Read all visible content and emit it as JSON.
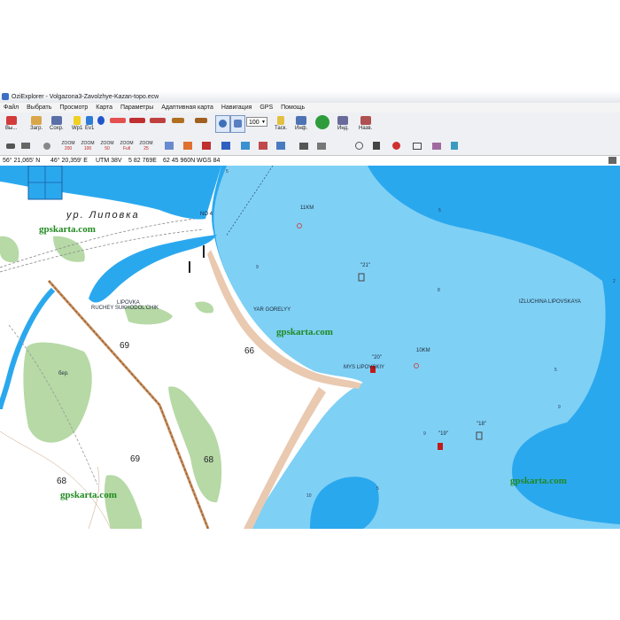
{
  "window": {
    "title": "OziExplorer - Volgazona3-Zavolzhye-Kazan-topo.ecw"
  },
  "menu": [
    "Файл",
    "Выбрать",
    "Просмотр",
    "Карта",
    "Параметры",
    "Адаптивная карта",
    "Навигация",
    "GPS",
    "Помощь"
  ],
  "toolbar1": {
    "exit": "Вы...",
    "load": "Загр.",
    "save": "Сохр.",
    "wp1": "Wp1",
    "ev1": "Ev1",
    "zoom_value": "100",
    "task": "Таск.",
    "info": "Инф.",
    "ind": "Инд.",
    "nav": "Назв."
  },
  "toolbar2": {
    "zoom_buttons": [
      "200",
      "100",
      "50",
      "Full",
      "25"
    ]
  },
  "watermark": "gpskarta.com",
  "status": {
    "lat": "56° 21,065' N",
    "lon": "46° 20,359' E",
    "utm": "UTM  38V",
    "easting": "5 82 769E",
    "northing": "62 45 960N",
    "datum": "WGS 84"
  },
  "map": {
    "labels": {
      "lipovka": "ур. Липовка",
      "no4": "NO 4",
      "lipovka_small": "LIPOVKA",
      "ruchey": "RUCHEY SUKHODOL'CHIK",
      "yar": "YAR GORELYY",
      "izluchina": "IZLUCHINA LIPOVSKAYA",
      "mys": "MYS LIPOVSKIY",
      "km11": "11KM",
      "km10": "10KM",
      "q21": "\"21\"",
      "q20": "\"20\"",
      "q19": "\"19\"",
      "q18": "\"18\"",
      "ber": "бер."
    },
    "heights": [
      "69",
      "66",
      "69",
      "68",
      "68"
    ],
    "depths": [
      "5",
      "9",
      "8",
      "5",
      "9",
      "10",
      "5",
      "2",
      "9",
      "5"
    ]
  },
  "colors": {
    "water_deep": "#2aa8ee",
    "water_shallow": "#7fd0f5",
    "land": "#ffffff",
    "forest": "#b6d9a6",
    "watermark": "#1f8a1f"
  }
}
